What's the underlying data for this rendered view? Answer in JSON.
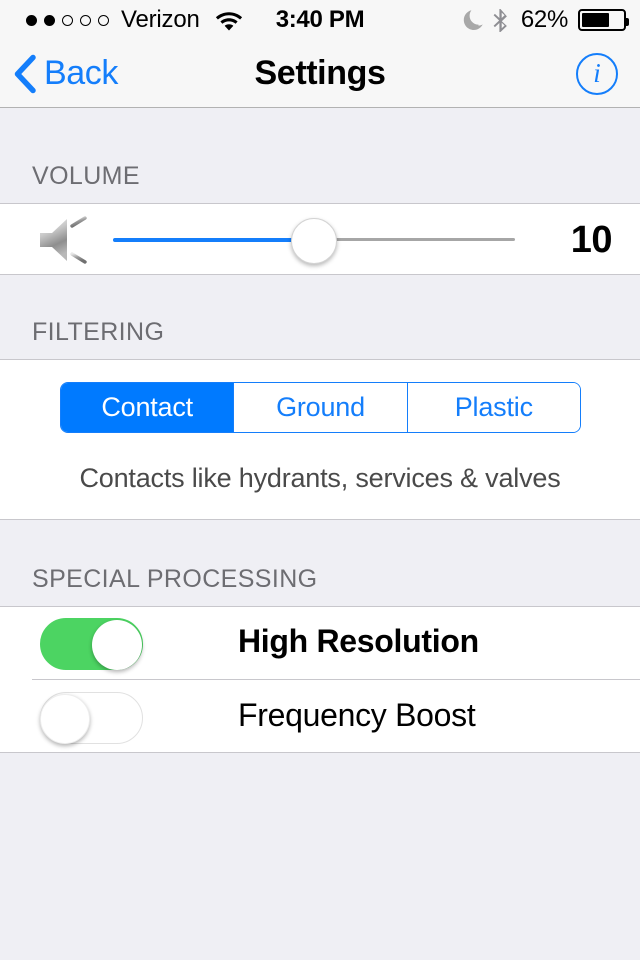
{
  "status_bar": {
    "signal_dots_total": 5,
    "signal_dots_filled": 2,
    "carrier": "Verizon",
    "wifi_icon": "wifi-icon",
    "time": "3:40 PM",
    "do_not_disturb_icon": "moon-icon",
    "bluetooth_icon": "bluetooth-icon",
    "battery_percent_label": "62%",
    "battery_level": 62
  },
  "nav_bar": {
    "back_label": "Back",
    "back_chevron_icon": "chevron-left-icon",
    "title": "Settings",
    "info_icon": "info-circle-icon",
    "info_glyph": "i"
  },
  "sections": {
    "volume": {
      "header": "VOLUME",
      "speaker_icon": "speaker-volume-icon",
      "value_label": "10",
      "slider": {
        "value": 10,
        "percent": 50,
        "min": 0,
        "max": 20
      }
    },
    "filtering": {
      "header": "FILTERING",
      "segments": [
        {
          "label": "Contact",
          "selected": true
        },
        {
          "label": "Ground",
          "selected": false
        },
        {
          "label": "Plastic",
          "selected": false
        }
      ],
      "caption": "Contacts like hydrants, services & valves"
    },
    "special_processing": {
      "header": "SPECIAL PROCESSING",
      "rows": [
        {
          "label": "High Resolution",
          "enabled": true
        },
        {
          "label": "Frequency Boost",
          "enabled": false
        }
      ]
    }
  },
  "colors": {
    "accent_blue": "#147EFB",
    "segment_selected_blue": "#007AFF",
    "toggle_on_green": "#4CD462",
    "group_background": "#EFEFF4",
    "header_text": "#6D6D72",
    "separator": "#C8C7CC"
  }
}
